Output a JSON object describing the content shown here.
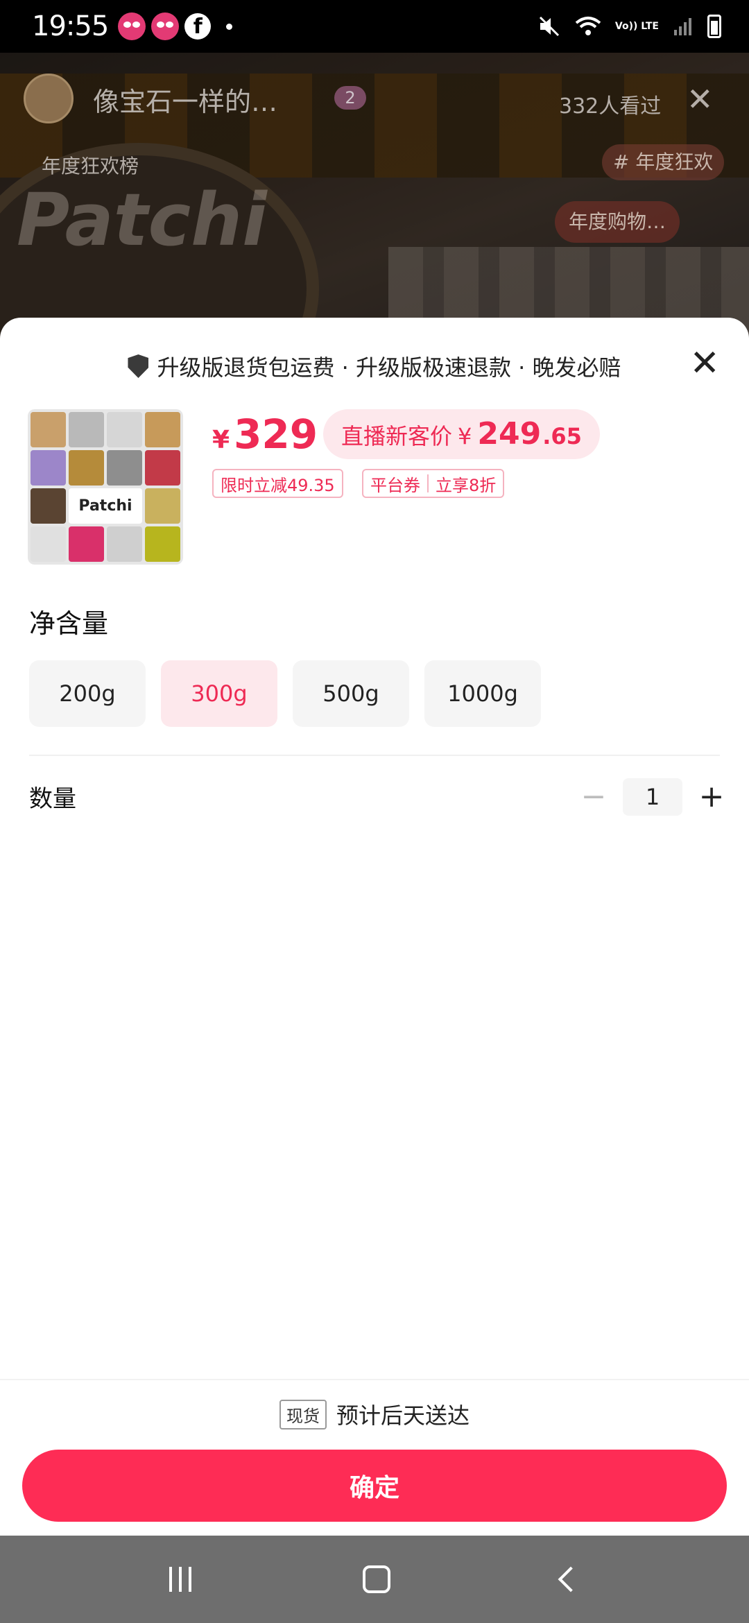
{
  "status_bar": {
    "time": "19:55",
    "left_icons": [
      "panda-icon",
      "panda-icon",
      "facebook-icon",
      "dot"
    ],
    "volte": "Vo)) LTE",
    "right_icons": [
      "mute-icon",
      "wifi-icon",
      "signal-icon",
      "battery-icon"
    ]
  },
  "live": {
    "host_name": "像宝石一样的…",
    "fan_level": "2",
    "viewers": "332人看过",
    "rank_label": "年度狂欢榜",
    "tag": "# 年度狂欢",
    "watermark": "Patchi",
    "promo": "年度购物…"
  },
  "sheet": {
    "guarantee": "升级版退货包运费 · 升级版极速退款 · 晚发必赔",
    "product": {
      "thumb_logo": "Patchi",
      "currency": "¥",
      "price": "329",
      "new_customer_label": "直播新客价",
      "new_customer_currency": "¥",
      "new_customer_price_int": "249",
      "new_customer_price_dec": ".65",
      "discount_tag": "限时立减49.35",
      "coupon_tag_a": "平台券",
      "coupon_tag_b": "立享8折"
    },
    "spec": {
      "title": "净含量",
      "options": [
        "200g",
        "300g",
        "500g",
        "1000g"
      ],
      "selected": "300g"
    },
    "quantity": {
      "label": "数量",
      "value": "1",
      "minus": "−",
      "plus": "+"
    },
    "delivery": {
      "badge": "现货",
      "text": "预计后天送达"
    },
    "confirm_label": "确定",
    "close_glyph": "✕"
  },
  "colors": {
    "accent": "#fe2c55",
    "price_red": "#ee2a54",
    "pill_bg": "#fde8ec"
  }
}
